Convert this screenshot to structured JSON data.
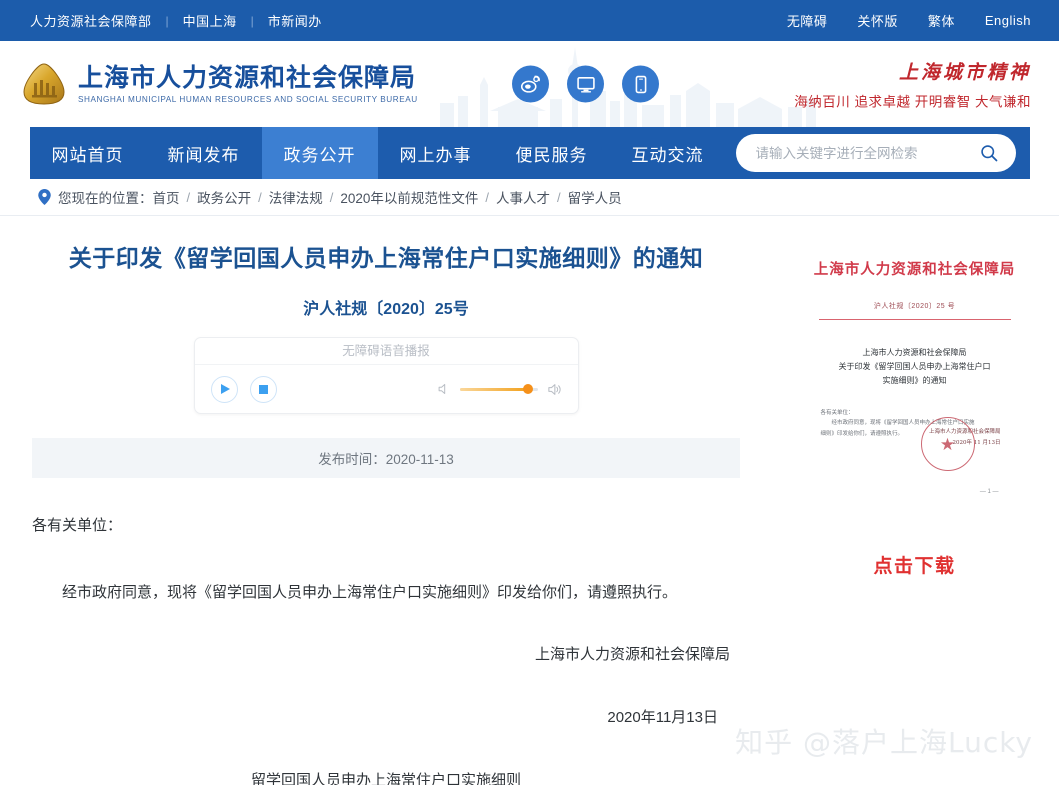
{
  "topbar": {
    "left_links": [
      "人力资源社会保障部",
      "中国上海",
      "市新闻办"
    ],
    "right_links": [
      "无障碍",
      "关怀版",
      "繁体",
      "English"
    ],
    "bg_color": "#1c5cab"
  },
  "header": {
    "logo_cn": "上海市人力资源和社会保障局",
    "logo_en": "SHANGHAI MUNICIPAL HUMAN RESOURCES AND SOCIAL SECURITY BUREAU",
    "logo_color": "#174f9c",
    "social_icons": [
      "weibo-icon",
      "desktop-icon",
      "mobile-icon"
    ],
    "social_color": "#3478cd",
    "spirit_title": "上海城市精神",
    "spirit_sub": "海纳百川 追求卓越 开明睿智 大气谦和",
    "spirit_color": "#c0272d"
  },
  "nav": {
    "items": [
      {
        "label": "网站首页",
        "active": false
      },
      {
        "label": "新闻发布",
        "active": false
      },
      {
        "label": "政务公开",
        "active": true
      },
      {
        "label": "网上办事",
        "active": false
      },
      {
        "label": "便民服务",
        "active": false
      },
      {
        "label": "互动交流",
        "active": false
      }
    ],
    "bg_color": "#1d5cad",
    "active_color": "#3c7fd2"
  },
  "search": {
    "placeholder": "请输入关键字进行全网检索",
    "value": "",
    "icon": "search-icon"
  },
  "breadcrumb": {
    "label": "您现在的位置：",
    "items": [
      "首页",
      "政务公开",
      "法律法规",
      "2020年以前规范性文件",
      "人事人才",
      "留学人员"
    ],
    "separator": "/",
    "pin_icon": "location-pin-icon"
  },
  "article": {
    "title": "关于印发《留学回国人员申办上海常住户口实施细则》的通知",
    "doc_number": "沪人社规〔2020〕25号",
    "title_color": "#1b5291",
    "publish_label": "发布时间：2020-11-13",
    "paragraphs": [
      "各有关单位：",
      "经市政府同意，现将《留学回国人员申办上海常住户口实施细则》印发给你们，请遵照执行。"
    ],
    "signature": "上海市人力资源和社会保障局",
    "signature_date": "2020年11月13日",
    "sub_document_title": "留学回国人员申办上海常住户口实施细则"
  },
  "audio": {
    "caption": "无障碍语音播报",
    "play_icon": "play-icon",
    "stop_icon": "stop-icon",
    "mute_icon": "volume-mute-icon",
    "volume_icon": "volume-high-icon",
    "volume_percent": 88,
    "slider_color": "#f5901a"
  },
  "sidebar": {
    "thumb_header": "上海市人力资源和社会保障局",
    "thumb_docnum": "沪人社规〔2020〕25 号",
    "thumb_body": "上海市人力资源和社会保障局\n关于印发《留学回国人员申办上海常住户口\n实施细则》的通知",
    "thumb_small": "各有关单位：\n　　经市政府同意，现将《留学回国人员申办上海常住户口实施\n细则》印发给你们，请遵照执行。",
    "thumb_seal": "上海市人力资源和社会保障局\n2020年 11 月13日",
    "thumb_pagenum": "— 1 —",
    "download_label": "点击下载",
    "download_color": "#e03131"
  },
  "watermark": {
    "text": "知乎 @落户上海Lucky"
  }
}
